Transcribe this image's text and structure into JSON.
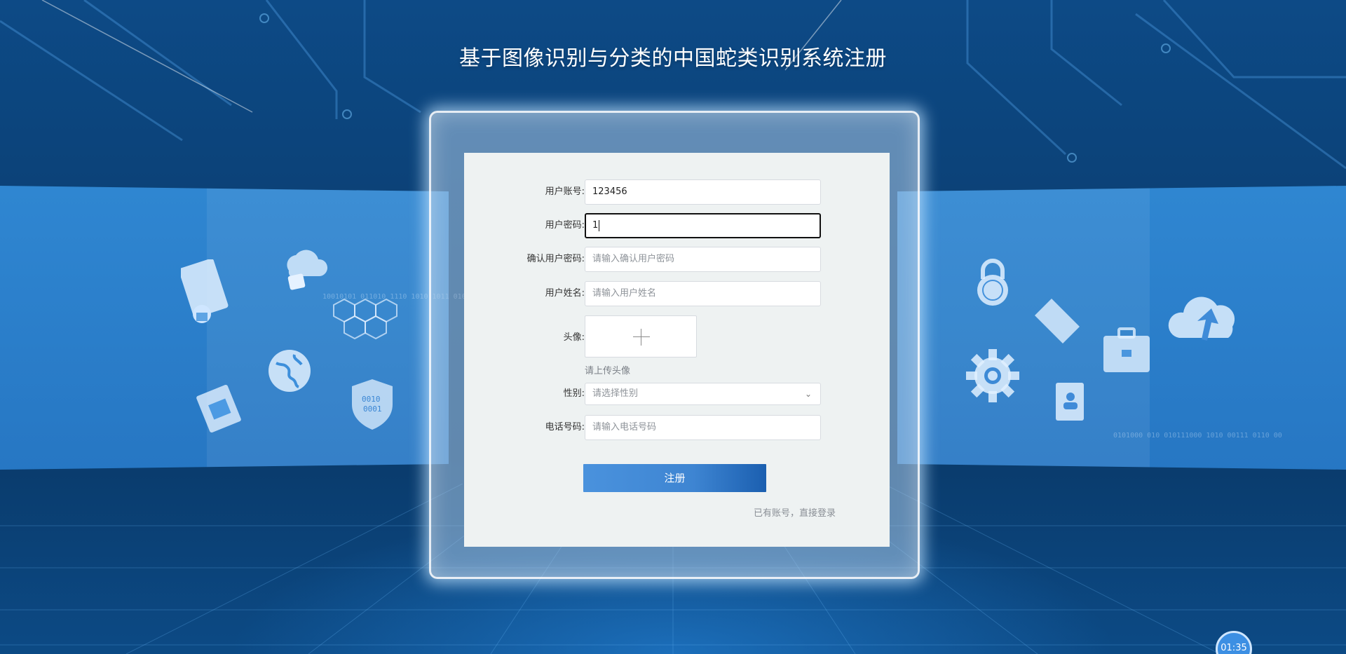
{
  "page": {
    "title": "基于图像识别与分类的中国蛇类识别系统注册"
  },
  "form": {
    "account": {
      "label": "用户账号:",
      "value": "123456"
    },
    "password": {
      "label": "用户密码:",
      "value": "1"
    },
    "confirm_password": {
      "label": "确认用户密码:",
      "placeholder": "请输入确认用户密码"
    },
    "real_name": {
      "label": "用户姓名:",
      "placeholder": "请输入用户姓名"
    },
    "avatar": {
      "label": "头像:",
      "tip": "请上传头像"
    },
    "gender": {
      "label": "性别:",
      "placeholder": "请选择性别"
    },
    "phone": {
      "label": "电话号码:",
      "placeholder": "请输入电话号码"
    },
    "submit_label": "注册",
    "login_link": "已有账号，直接登录"
  },
  "timer": {
    "value": "01:35"
  },
  "decor": {
    "icons": [
      "server-lock-icon",
      "cloud-lock-icon",
      "hexagon-icon",
      "globe-icon",
      "photos-icon",
      "shield-binary-icon",
      "padlock-globe-icon",
      "folder-icon",
      "briefcase-icon",
      "cloud-upload-icon",
      "gear-icon",
      "contact-book-icon"
    ],
    "binary_text_left": "10010101 011010 1110 1010 1011 010",
    "binary_text_right": "0101000 010 010111000 1010 00111 0110 00"
  },
  "colors": {
    "background": "#0b3f73",
    "band": "#318ad6",
    "card": "#eef2f2",
    "button": "#4a92dd",
    "frame_glow": "#bee1ff"
  }
}
